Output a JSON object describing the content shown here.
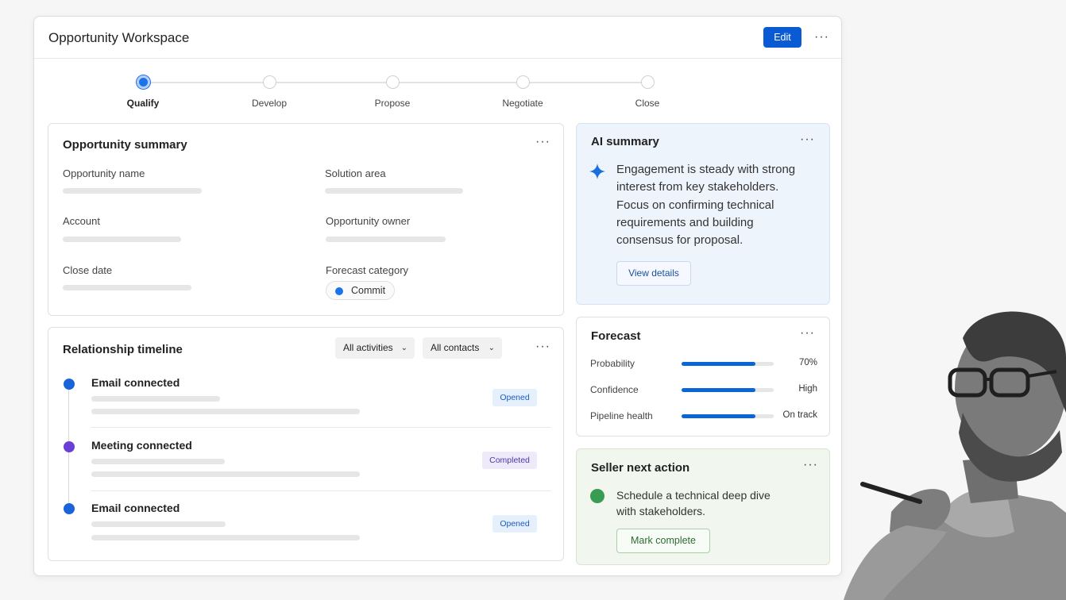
{
  "window": {
    "title": "Opportunity Workspace",
    "edit_label": "Edit",
    "more_label": "···"
  },
  "stages": [
    {
      "label": "Qualify",
      "active": true
    },
    {
      "label": "Develop",
      "active": false
    },
    {
      "label": "Propose",
      "active": false
    },
    {
      "label": "Negotiate",
      "active": false
    },
    {
      "label": "Close",
      "active": false
    }
  ],
  "summary": {
    "title": "Opportunity summary",
    "fields": {
      "name": "Opportunity name",
      "solution": "Solution area",
      "account": "Account",
      "owner": "Opportunity owner",
      "close_date": "Close date",
      "forecast_category": "Forecast category"
    },
    "forecast_value": "Commit"
  },
  "timeline": {
    "title": "Relationship timeline",
    "filters": {
      "activities": "All activities",
      "contacts": "All contacts"
    },
    "items": [
      {
        "title": "Email connected",
        "status": "Opened",
        "dot_color": "#1a63d8"
      },
      {
        "title": "Meeting connected",
        "status": "Completed",
        "dot_color": "#6a3fd6"
      },
      {
        "title": "Email connected",
        "status": "Opened",
        "dot_color": "#1a63d8"
      }
    ]
  },
  "ai": {
    "title": "AI summary",
    "text": "Engagement is steady with strong interest from key stakeholders. Focus on confirming technical requirements and building consensus for proposal.",
    "button": "View details",
    "icon": "sparkle-icon"
  },
  "forecast": {
    "title": "Forecast",
    "rows": [
      {
        "label": "Probability",
        "value": "70%",
        "level": 0.8
      },
      {
        "label": "Confidence",
        "value": "High",
        "level": 0.8
      },
      {
        "label": "Pipeline health",
        "value": "On track",
        "level": 0.8
      }
    ]
  },
  "next_action": {
    "title": "Seller next action",
    "text": "Schedule a technical deep dive with stakeholders.",
    "button": "Mark complete"
  },
  "colors": {
    "accent": "#0a5bd3",
    "ai_bg": "#eef4fc",
    "next_bg": "#f1f7ef",
    "success": "#3a9b53"
  }
}
